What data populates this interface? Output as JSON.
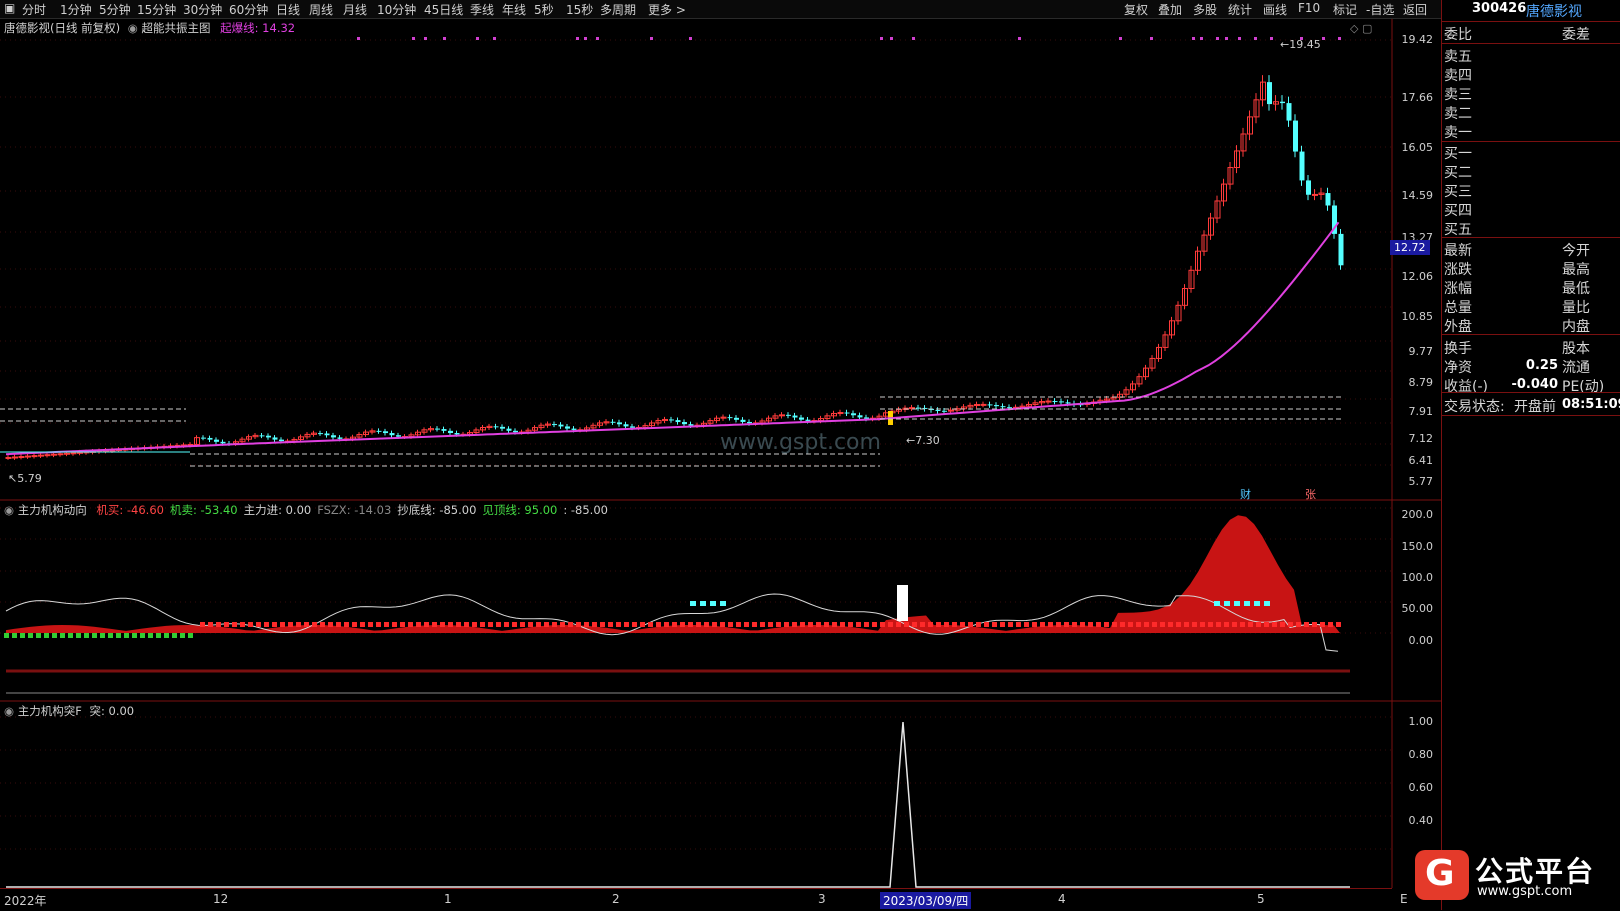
{
  "toolbar": {
    "left_items": [
      "分时",
      "1分钟",
      "5分钟",
      "15分钟",
      "30分钟",
      "60分钟",
      "日线",
      "周线",
      "月线",
      "10分钟",
      "45日线",
      "季线",
      "年线",
      "5秒",
      "15秒",
      "多周期",
      "更多 >"
    ],
    "right_items": [
      "复权",
      "叠加",
      "多股",
      "统计",
      "画线",
      "F10",
      "标记",
      "-自选",
      "返回"
    ]
  },
  "stock": {
    "code": "300426",
    "name": "唐德影视"
  },
  "main_pane": {
    "title": "唐德影视(日线 前复权)",
    "indicator_name": "超能共振主图",
    "indicator_value_label": "起爆线: 14.32",
    "y_labels": [
      "19.42",
      "17.66",
      "16.05",
      "14.59",
      "13.27",
      "12.06",
      "10.85",
      "9.77",
      "8.79",
      "7.91",
      "7.12",
      "6.41",
      "5.77"
    ],
    "high_annotation": "19.45",
    "low_annotation": "5.79",
    "mid_annotation": "7.30",
    "current_price_tag": "12.72",
    "marker_cai": "财",
    "marker_zhang": "张",
    "watermark": "www.gspt.com"
  },
  "colors": {
    "up": "#ff3b3b",
    "down": "#54ffff",
    "ma": "#e040e0",
    "frame": "#7a1010",
    "sell_text": "#ff3b3b",
    "buy_text": "#44dd44",
    "area": "#c81414"
  },
  "pane2": {
    "title": "主力机构动向",
    "items": [
      {
        "label": "机买:",
        "value": "-46.60",
        "color": "#ff4444"
      },
      {
        "label": "机卖:",
        "value": "-53.40",
        "color": "#44dd44"
      },
      {
        "label": "主力进:",
        "value": "0.00",
        "color": "#d0d0d0"
      },
      {
        "label": "FSZX:",
        "value": "-14.03",
        "color": "#888888"
      },
      {
        "label": "抄底线:",
        "value": "-85.00",
        "color": "#d0d0d0"
      },
      {
        "label": "见顶线:",
        "value": "95.00",
        "color": "#44dd44"
      },
      {
        "label": ":",
        "value": "-85.00",
        "color": "#d0d0d0"
      }
    ],
    "y_labels": [
      "200.0",
      "150.0",
      "100.0",
      "50.00",
      "0.00"
    ]
  },
  "pane3": {
    "title": "主力机构突F",
    "value_label": "突: 0.00",
    "y_labels": [
      "1.00",
      "0.80",
      "0.60",
      "0.40"
    ]
  },
  "time_axis": {
    "labels": [
      "2022年",
      "12",
      "1",
      "2",
      "3",
      "4",
      "5"
    ],
    "cursor_date": "2023/03/09/四",
    "end_label": "E"
  },
  "right_panel": {
    "header_left": "委比",
    "header_right": "委差",
    "sell_rows": [
      "卖五",
      "卖四",
      "卖三",
      "卖二",
      "卖一"
    ],
    "buy_rows": [
      "买一",
      "买二",
      "买三",
      "买四",
      "买五"
    ],
    "quote_rows": [
      {
        "left": "最新",
        "right": "今开"
      },
      {
        "left": "涨跌",
        "right": "最高"
      },
      {
        "left": "涨幅",
        "right": "最低"
      },
      {
        "left": "总量",
        "right": "量比"
      },
      {
        "left": "外盘",
        "right": "内盘"
      }
    ],
    "fin_rows": [
      {
        "left": "换手",
        "value": "",
        "right": "股本"
      },
      {
        "left": "净资",
        "value": "0.25",
        "right": "流通"
      },
      {
        "left": "收益(-)",
        "value": "-0.040",
        "right": "PE(动)"
      }
    ],
    "trade_status_label": "交易状态:",
    "trade_status_value": "开盘前",
    "trade_time": "08:51:09"
  },
  "logo": {
    "cn": "公式平台",
    "url": "www.gspt.com"
  }
}
